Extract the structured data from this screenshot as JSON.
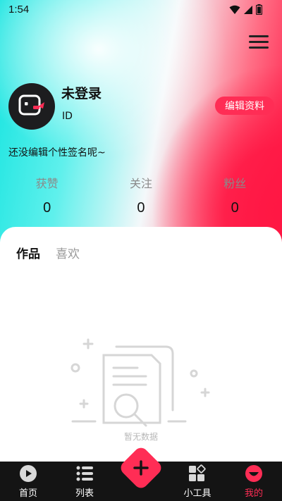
{
  "status_bar": {
    "time": "1:54"
  },
  "profile": {
    "username": "未登录",
    "id_label": "ID",
    "edit_button": "编辑资料",
    "signature": "还没编辑个性签名呢~"
  },
  "stats": [
    {
      "label": "获赞",
      "value": "0"
    },
    {
      "label": "关注",
      "value": "0"
    },
    {
      "label": "粉丝",
      "value": "0"
    }
  ],
  "tabs": [
    {
      "label": "作品",
      "active": true
    },
    {
      "label": "喜欢",
      "active": false
    }
  ],
  "empty_state": {
    "text": "暂无数据",
    "icon": "empty-document-search-icon"
  },
  "bottom_nav": {
    "items": [
      {
        "label": "首页",
        "icon": "play-icon"
      },
      {
        "label": "列表",
        "icon": "list-icon"
      },
      {
        "label": "",
        "icon": "plus-icon"
      },
      {
        "label": "小工具",
        "icon": "tools-grid-icon"
      },
      {
        "label": "我的",
        "icon": "smile-profile-icon",
        "active": true
      }
    ]
  },
  "colors": {
    "accent": "#ff2d55",
    "nav_bg": "#141414",
    "gradient_cyan": "#16e4e0",
    "gradient_red": "#ff1744"
  }
}
